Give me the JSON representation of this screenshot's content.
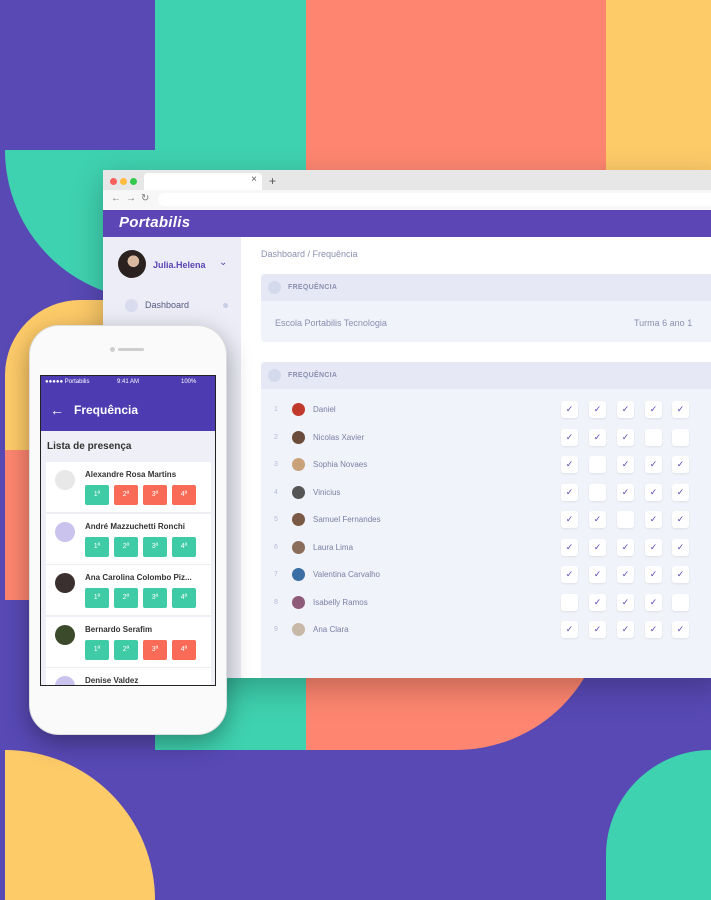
{
  "browser": {
    "brand": "Portabilis",
    "tab_close": "×",
    "new_tab": "+",
    "nav_back": "←",
    "nav_forward": "→",
    "nav_reload": "↻",
    "user": {
      "name": "Julia.Helena"
    },
    "sidebar": {
      "items": [
        {
          "label": "Dashboard"
        }
      ]
    },
    "breadcrumb": "Dashboard / Frequência",
    "card1": {
      "title": "FREQUÊNCIA",
      "school": "Escola Portabilis Tecnologia",
      "class": "Turma 6 ano 1"
    },
    "card2": {
      "title": "FREQUÊNCIA"
    },
    "check_glyph": "✓",
    "students": [
      {
        "num": "1",
        "name": "Daniel",
        "checks": [
          true,
          true,
          true,
          true,
          true
        ]
      },
      {
        "num": "2",
        "name": "Nicolas Xavier",
        "checks": [
          true,
          true,
          true,
          false,
          false
        ]
      },
      {
        "num": "3",
        "name": "Sophia Novaes",
        "checks": [
          true,
          false,
          true,
          true,
          true
        ]
      },
      {
        "num": "4",
        "name": "Vinicius",
        "checks": [
          true,
          false,
          true,
          true,
          true
        ]
      },
      {
        "num": "5",
        "name": "Samuel Fernandes",
        "checks": [
          true,
          true,
          false,
          true,
          true
        ]
      },
      {
        "num": "6",
        "name": "Laura Lima",
        "checks": [
          true,
          true,
          true,
          true,
          true
        ]
      },
      {
        "num": "7",
        "name": "Valentina Carvalho",
        "checks": [
          true,
          true,
          true,
          true,
          true
        ]
      },
      {
        "num": "8",
        "name": "Isabelly Ramos",
        "checks": [
          false,
          true,
          true,
          true,
          false
        ]
      },
      {
        "num": "9",
        "name": "Ana Clara",
        "checks": [
          true,
          true,
          true,
          true,
          true
        ]
      }
    ]
  },
  "phone": {
    "status": {
      "carrier": "●●●●● Portabilis",
      "time": "9:41 AM",
      "battery": "100%"
    },
    "back_icon": "←",
    "title": "Frequência",
    "list_title": "Lista de presença",
    "students": [
      {
        "name": "Alexandre Rosa Martins",
        "periods": [
          {
            "label": "1ª",
            "status": "present"
          },
          {
            "label": "2ª",
            "status": "absent"
          },
          {
            "label": "3ª",
            "status": "absent"
          },
          {
            "label": "4ª",
            "status": "absent"
          }
        ]
      },
      {
        "name": "André Mazzuchetti Ronchi",
        "periods": [
          {
            "label": "1ª",
            "status": "present"
          },
          {
            "label": "2ª",
            "status": "present"
          },
          {
            "label": "3ª",
            "status": "present"
          },
          {
            "label": "4ª",
            "status": "present"
          }
        ]
      },
      {
        "name": "Ana Carolina Colombo Piz...",
        "periods": [
          {
            "label": "1ª",
            "status": "present"
          },
          {
            "label": "2ª",
            "status": "present"
          },
          {
            "label": "3ª",
            "status": "present"
          },
          {
            "label": "4ª",
            "status": "present"
          }
        ]
      },
      {
        "name": "Bernardo Serafim",
        "periods": [
          {
            "label": "1ª",
            "status": "present"
          },
          {
            "label": "2ª",
            "status": "present"
          },
          {
            "label": "3ª",
            "status": "absent"
          },
          {
            "label": "4ª",
            "status": "absent"
          }
        ]
      },
      {
        "name": "Denise Valdez",
        "periods": []
      }
    ]
  },
  "colors": {
    "purple": "#5c45b4",
    "green": "#3fd2b0",
    "coral": "#fe8670",
    "yellow": "#fecb69",
    "present": "#3ecba5",
    "absent": "#f96b56"
  }
}
